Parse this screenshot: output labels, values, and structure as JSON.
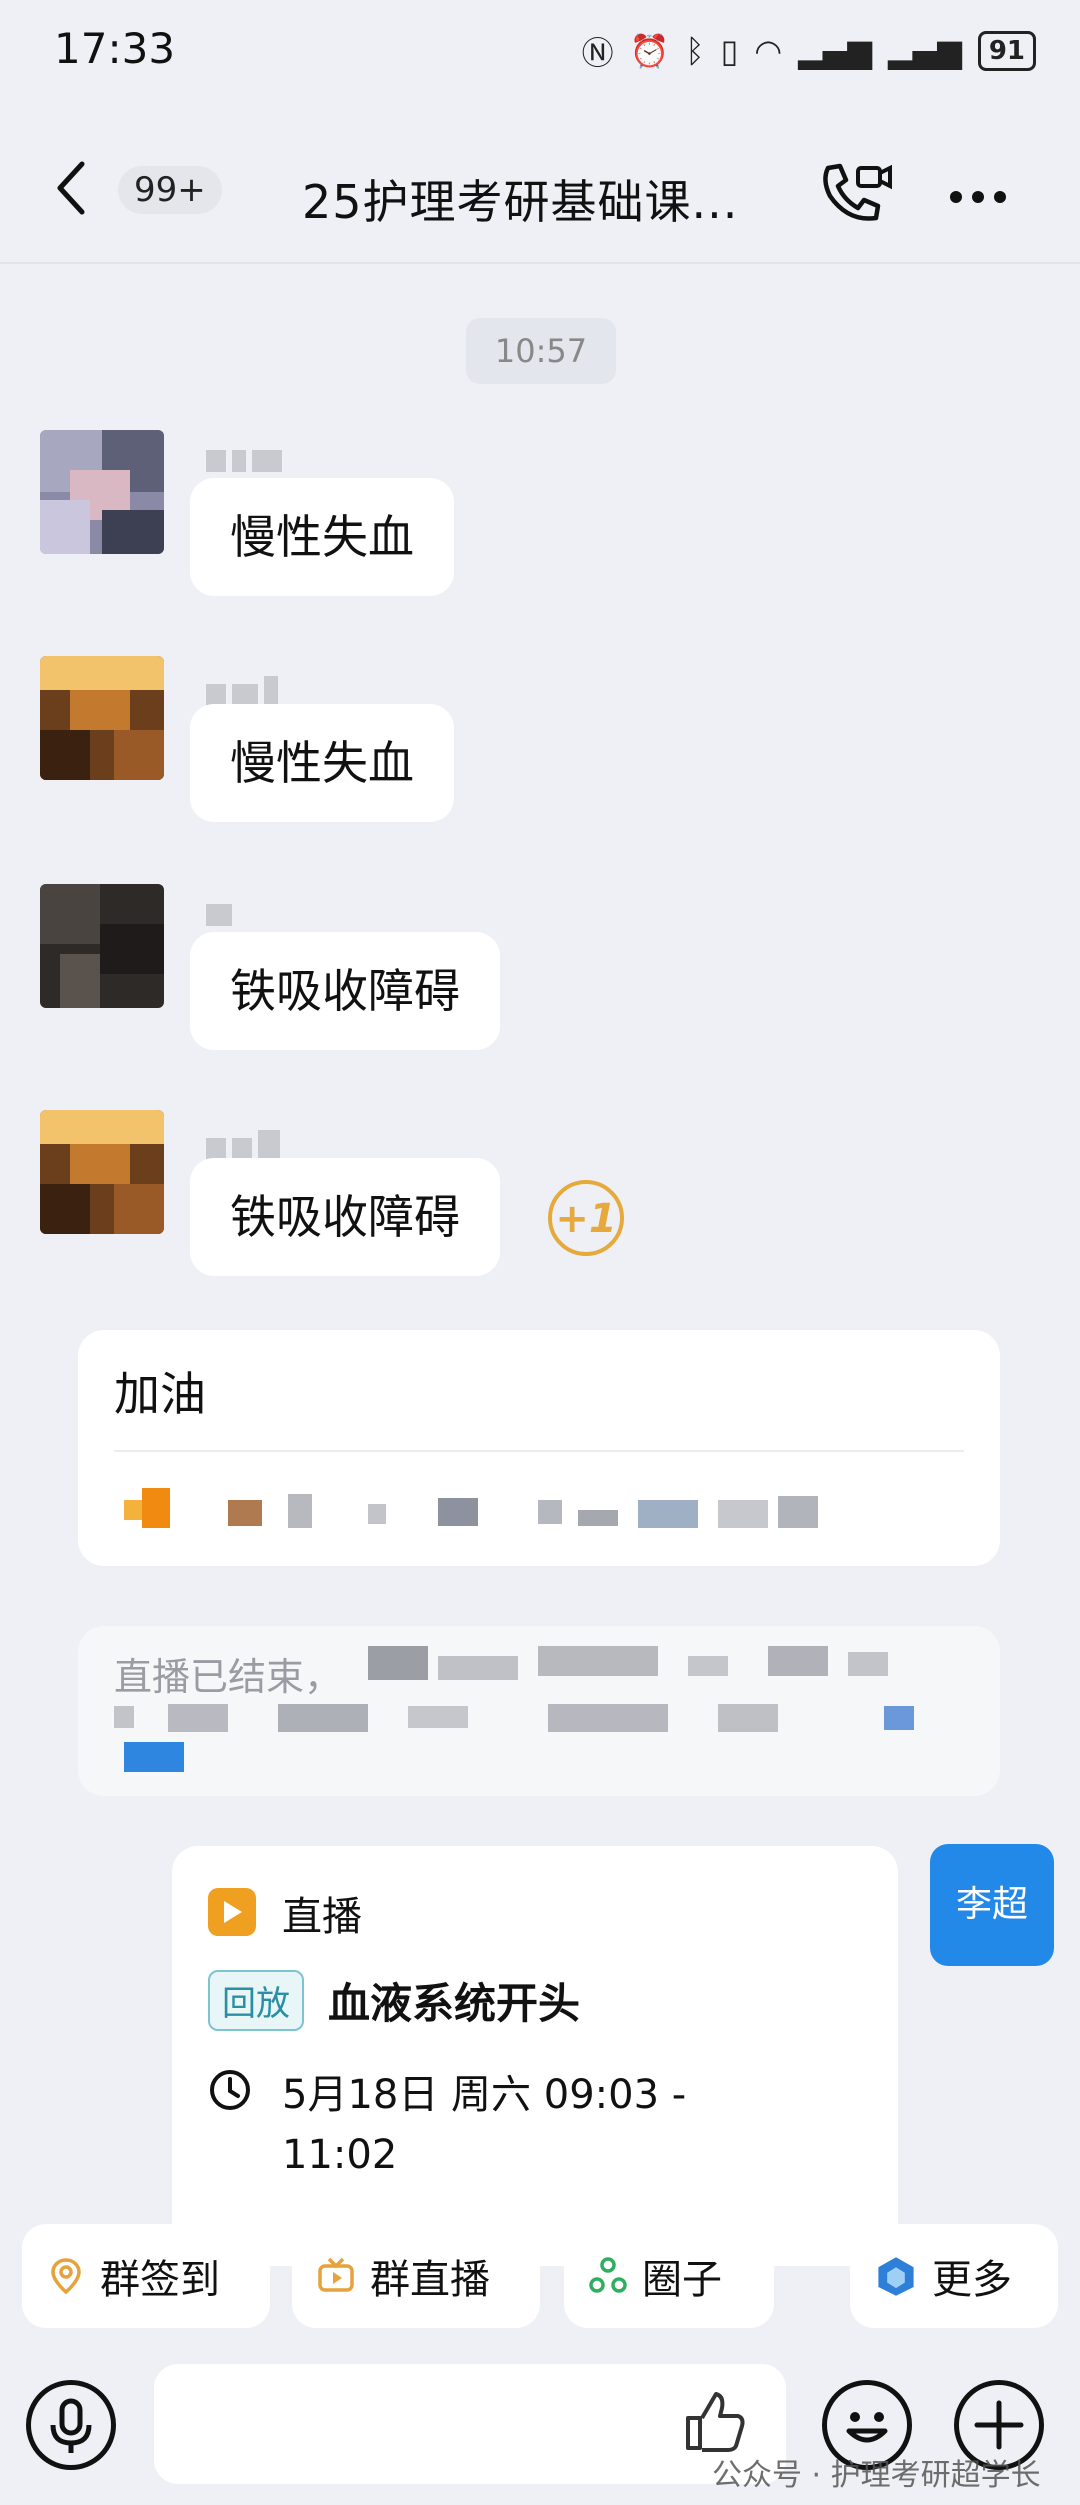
{
  "status_bar": {
    "time": "17:33",
    "battery": "91"
  },
  "header": {
    "badge": "99+",
    "title": "25护理考研基础课..."
  },
  "timestamp": "10:57",
  "messages": [
    {
      "text": "慢性失血"
    },
    {
      "text": "慢性失血"
    },
    {
      "text": "铁吸收障碍"
    },
    {
      "text": "铁吸收障碍",
      "reaction": "+1"
    }
  ],
  "notice_card": {
    "title": "加油"
  },
  "system_notice": {
    "text": "直播已结束，"
  },
  "live_card": {
    "type_label": "直播",
    "tag": "回放",
    "title": "血液系统开头",
    "time_line1": "5月18日 周六 09:03 -",
    "time_line2": "11:02"
  },
  "sender_label": "李超",
  "quick_actions": [
    {
      "label": "群签到",
      "icon": "checkin-icon"
    },
    {
      "label": "群直播",
      "icon": "live-tv-icon"
    },
    {
      "label": "圈子",
      "icon": "circle-icon"
    },
    {
      "label": "更多",
      "icon": "more-app-icon"
    }
  ],
  "watermark": "公众号 · 护理考研超学长",
  "colors": {
    "accent": "#2389e8",
    "live": "#f0a020",
    "reaction": "#e6a93c"
  }
}
